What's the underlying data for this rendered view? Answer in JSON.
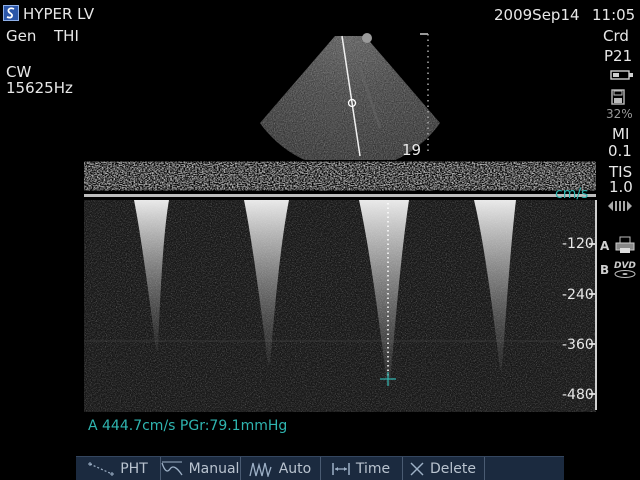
{
  "header": {
    "app_title": "HYPER LV",
    "mode1": "Gen",
    "mode2": "THI",
    "date": "2009Sep14",
    "time": "11:05"
  },
  "left_panel": {
    "mode": "CW",
    "prf": "15625Hz"
  },
  "right_panel": {
    "preset": "Crd",
    "probe": "P21",
    "storage_percent": "32%",
    "mi_label": "MI",
    "mi_value": "0.1",
    "tis_label": "TIS",
    "tis_value": "1.0",
    "print_a_label": "A",
    "print_b_label": "B"
  },
  "image": {
    "depth_value": "19"
  },
  "spectrum": {
    "units": "cm/s",
    "scale_labels": [
      "-120",
      "-240",
      "-360",
      "-480"
    ]
  },
  "measurement": {
    "text": "A  444.7cm/s PGr:79.1mmHg"
  },
  "menu": {
    "items": [
      {
        "label": "PHT",
        "icon": "pht-icon"
      },
      {
        "label": "Manual",
        "icon": "manual-trace-icon"
      },
      {
        "label": "Auto",
        "icon": "auto-trace-icon"
      },
      {
        "label": "Time",
        "icon": "time-caliper-icon"
      },
      {
        "label": "Delete",
        "icon": "delete-icon"
      }
    ]
  },
  "colors": {
    "accent_cyan": "#2fb5b0",
    "menu_bg": "#1b2a3f"
  }
}
